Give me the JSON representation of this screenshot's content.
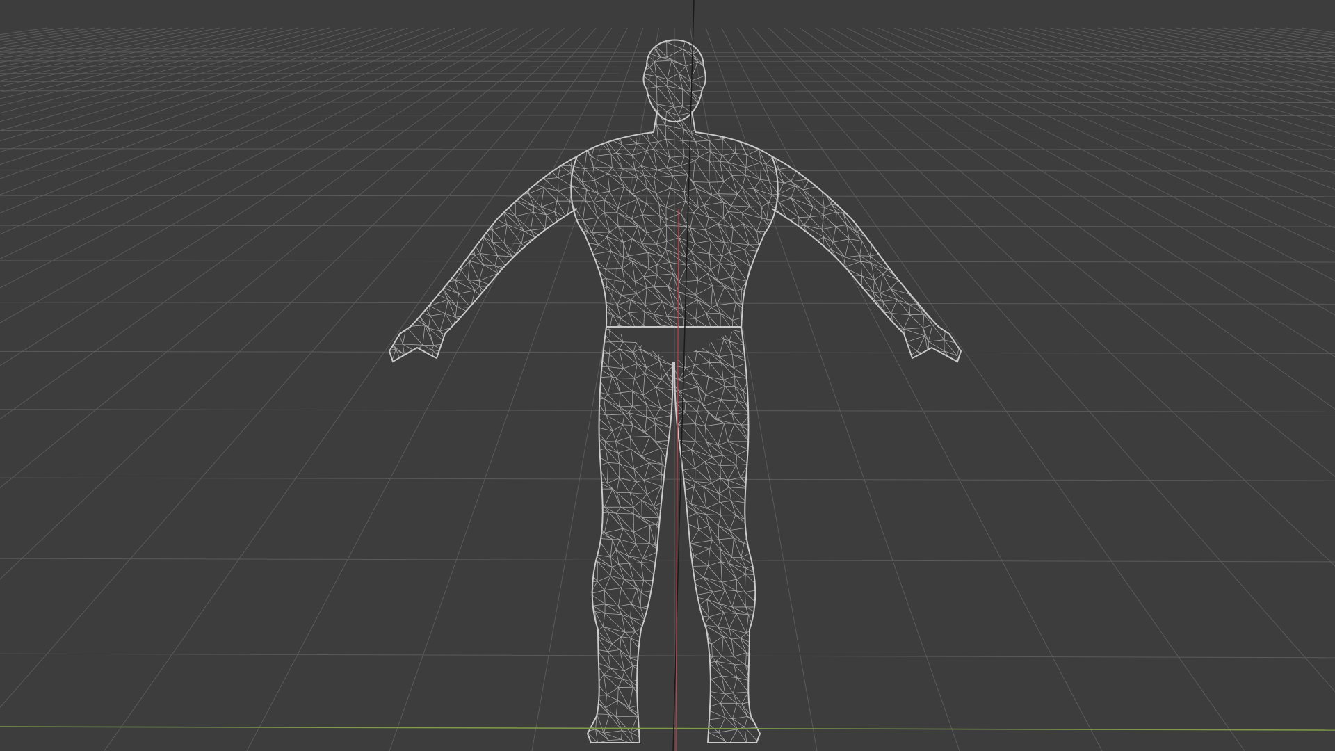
{
  "viewport": {
    "mode": "wireframe",
    "object": "humanoid-character-mesh",
    "view": "front-perspective",
    "show_floor_grid": true
  },
  "colors": {
    "background": "#3d3d3d",
    "grid_line": "#5a5a5a",
    "wire": "#c9c9c9",
    "axis_x": "#7f9b4a",
    "axis_z": "#1a1a1a",
    "axis_y": "#c0404a"
  }
}
